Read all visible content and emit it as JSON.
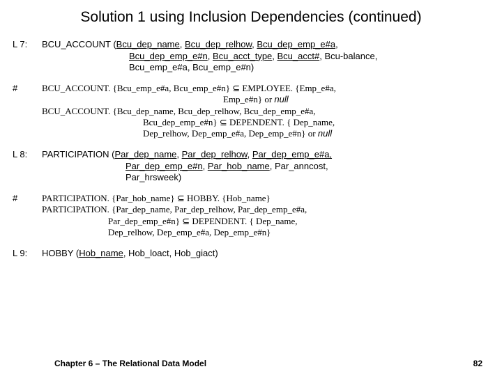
{
  "title": "Solution 1 using Inclusion Dependencies (continued)",
  "l7": {
    "label": "L 7:",
    "line1a": "BCU_ACCOUNT (",
    "line1b": "Bcu_dep_name",
    "line1c": ", ",
    "line1d": "Bcu_dep_relhow",
    "line1e": ", ",
    "line1f": "Bcu_dep_emp_e#a",
    "line1g": ",",
    "line2a": "Bcu_dep_emp_e#n",
    "line2b": ", ",
    "line2c": "Bcu_acct_type",
    "line2d": ", ",
    "line2e": "Bcu_acct#",
    "line2f": ", Bcu-balance,",
    "line3": "Bcu_emp_e#a, Bcu_emp_e#n)"
  },
  "c7": {
    "label": "#",
    "line1": "BCU_ACCOUNT. {Bcu_emp_e#a, Bcu_emp_e#n} ⊆ EMPLOYEE. {Emp_e#a,",
    "line2a": "                                               Emp_e#n} or ",
    "line2b": "null",
    "line3": "BCU_ACCOUNT. {Bcu_dep_name, Bcu_dep_relhow, Bcu_dep_emp_e#a,",
    "line4": "Bcu_dep_emp_e#n} ⊆ DEPENDENT. { Dep_name,",
    "line5a": "Dep_relhow, Dep_emp_e#a, Dep_emp_e#n} or ",
    "line5b": "null"
  },
  "l8": {
    "label": "L 8:",
    "line1a": "PARTICIPATION (",
    "line1b": "Par_dep_name",
    "line1c": ", ",
    "line1d": "Par_dep_relhow",
    "line1e": ", ",
    "line1f": "Par_dep_emp_e#a, ",
    "line2a": "Par_dep_emp_e#n",
    "line2b": ", ",
    "line2c": "Par_hob_name",
    "line2d": ", Par_anncost,",
    "line3": "Par_hrsweek)"
  },
  "c8": {
    "label": "#",
    "line1": "PARTICIPATION. {Par_hob_name} ⊆ HOBBY. {Hob_name}",
    "line2": "PARTICIPATION. {Par_dep_name, Par_dep_relhow, Par_dep_emp_e#a,",
    "line3": "Par_dep_emp_e#n} ⊆ DEPENDENT. { Dep_name,",
    "line4": "Dep_relhow, Dep_emp_e#a, Dep_emp_e#n}"
  },
  "l9": {
    "label": "L 9:",
    "line1a": "HOBBY (",
    "line1b": "Hob_name",
    "line1c": ", Hob_loact, Hob_giact)"
  },
  "footer": {
    "chapter": "Chapter 6 – The Relational Data Model",
    "page": "82"
  }
}
